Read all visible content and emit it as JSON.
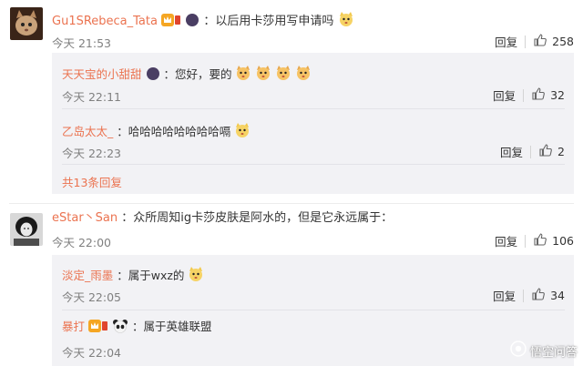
{
  "comments": [
    {
      "username": "Gu1SRebeca_Tata",
      "text": "：以后用卡莎用写申请吗",
      "time": "今天 21:53",
      "reply_label": "回复",
      "likes": "258",
      "more_replies": "共13条回复",
      "replies": [
        {
          "username": "天天宝的小甜甜",
          "text": "：您好，要的",
          "time": "今天 22:11",
          "reply_label": "回复",
          "likes": "32"
        },
        {
          "username": "乙岛太太_",
          "text": "：哈哈哈哈哈哈哈哈嗝",
          "time": "今天 22:23",
          "reply_label": "回复",
          "likes": "2"
        }
      ]
    },
    {
      "username": "eStar丶San",
      "text": "：众所周知ig卡莎皮肤是阿水的，但是它永远属于：",
      "time": "今天 22:00",
      "reply_label": "回复",
      "likes": "106",
      "replies": [
        {
          "username": "淡定_雨墨",
          "text": "：属于wxz的",
          "time": "今天 22:05",
          "reply_label": "回复",
          "likes": "34"
        },
        {
          "username": "暴打",
          "text": "：属于英雄联盟",
          "time": "今天 22:04"
        }
      ]
    }
  ],
  "watermark": {
    "text": "悟空问答"
  },
  "colors": {
    "username": "#eb7350",
    "reply_bg": "#f2f2f5",
    "time": "#808080"
  }
}
